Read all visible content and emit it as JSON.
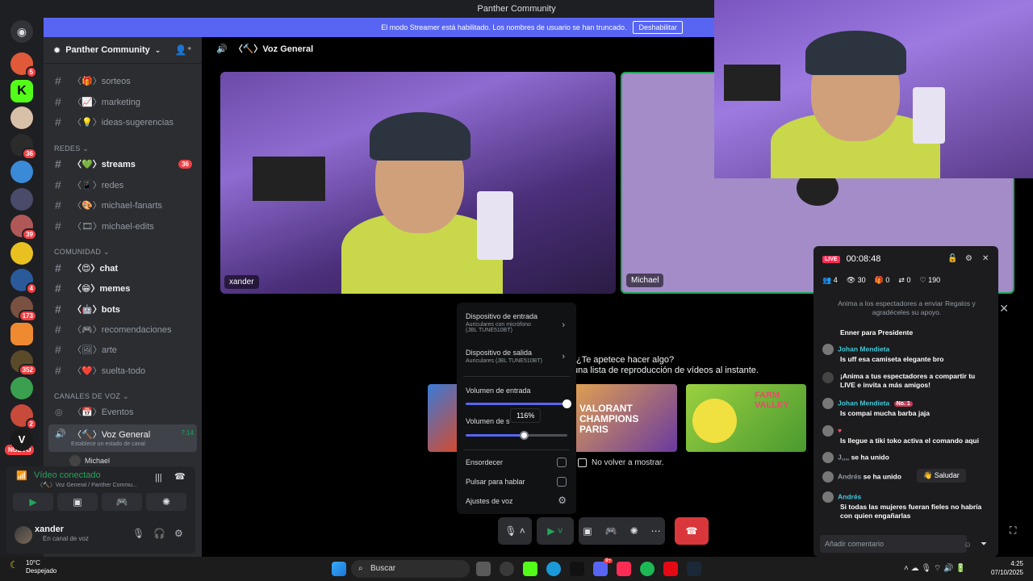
{
  "window": {
    "title": "Panther Community"
  },
  "streamer_banner": {
    "text": "El modo Streamer está habilitado. Los nombres de usuario se han truncado.",
    "button": "Deshabilitar"
  },
  "guild_list": {
    "badges": [
      "5",
      "36",
      "39",
      "4",
      "173",
      "352",
      "2"
    ],
    "nuevo": "NUEVO"
  },
  "server": {
    "name": "Panther Community",
    "channels_top": [
      {
        "name": "〈🎁〉sorteos"
      },
      {
        "name": "〈📈〉marketing"
      },
      {
        "name": "〈💡〉ideas-sugerencias"
      }
    ],
    "cat_redes": "REDES",
    "redes": [
      {
        "name": "〈💚〉streams",
        "count": "36"
      },
      {
        "name": "〈📱〉redes"
      },
      {
        "name": "〈🎨〉michael-fanarts"
      },
      {
        "name": "〈🎞〉michael-edits"
      }
    ],
    "cat_comunidad": "COMUNIDAD",
    "comunidad": [
      {
        "name": "〈😍〉chat"
      },
      {
        "name": "〈😁〉memes"
      },
      {
        "name": "〈🤖〉bots"
      },
      {
        "name": "〈🎮〉recomendaciones"
      },
      {
        "name": "〈🖼〉arte"
      },
      {
        "name": "〈❤️〉suelta-todo"
      }
    ],
    "cat_voz": "CANALES DE VOZ",
    "voz": [
      {
        "name": "〈📅〉Eventos"
      },
      {
        "name": "〈🔨〉Voz General",
        "time": "7:14",
        "status": "Establece un estado de canal"
      }
    ],
    "voice_member": "Michael"
  },
  "voice_panel": {
    "connected": "Vídeo conectado",
    "subtitle": "〈🔨〉Voz General / Panther Commu..."
  },
  "user": {
    "name": "xander",
    "status": "En canal de voz"
  },
  "stage": {
    "channel": "〈🔨〉Voz General",
    "tiles": [
      {
        "label": "xander"
      },
      {
        "label": "Michael"
      }
    ]
  },
  "promo": {
    "question": "¿Te apetece hacer algo?",
    "subtitle": "una lista de reproducción de vídeos al instante.",
    "cards": [
      "",
      "VALORANT CHAMPIONS PARIS",
      "",
      "FARM VALLEY"
    ],
    "dont_show": "No volver a mostrar."
  },
  "voice_menu": {
    "input_device": "Dispositivo de entrada",
    "input_device_sub1": "Auriculares con micrófono",
    "input_device_sub2": "(JBL TUNE510BT)",
    "output_device": "Dispositivo de salida",
    "output_device_sub": "Auriculares (JBL TUNE510BT)",
    "input_volume": "Volumen de entrada",
    "output_volume": "Volumen de s",
    "output_volume_tip": "116%",
    "input_volume_level": 1.0,
    "output_volume_level": 0.58,
    "deafen": "Ensordecer",
    "push_to_talk": "Pulsar para hablar",
    "voice_settings": "Ajustes de voz"
  },
  "live_panel": {
    "badge": "LIVE",
    "timer": "00:08:48",
    "stats": {
      "people": "4",
      "views": "30",
      "gifts": "0",
      "shares": "0",
      "likes": "190"
    },
    "intro": "Anima a los espectadores a enviar Regalos y agradéceles su apoyo.",
    "messages": [
      {
        "user": "",
        "text": "Enner para Presidente"
      },
      {
        "user": "Johan Mendieta",
        "text": "Is uff esa camiseta elegante bro"
      },
      {
        "user": "",
        "text": "¡Anima a tus espectadores a compartir tu LIVE e invita a más amigos!"
      },
      {
        "user": "Johan Mendieta",
        "badge": "No. 1",
        "text": "Is compai mucha barba jaja"
      },
      {
        "user": "",
        "text": "Is llegue a tiki toko activa el comando aqui"
      },
      {
        "user": "J,,,,",
        "text": "se ha unido"
      },
      {
        "user": "Andrés",
        "text": "se ha unido"
      },
      {
        "user": "Andrés",
        "text": "Si todas las mujeres fueran fieles no habría con quien engañarlas"
      }
    ],
    "saludar": "Saludar",
    "comment_placeholder": "Añadir comentario"
  },
  "taskbar": {
    "weather_temp": "10°C",
    "weather_desc": "Despejado",
    "search": "Buscar",
    "time": "4:25",
    "date": "07/10/2025",
    "discord_badge": "9+"
  },
  "colors": {
    "blurple": "#5865f2",
    "green": "#23a55a",
    "red": "#da373c",
    "live_pink": "#fe2c55"
  }
}
